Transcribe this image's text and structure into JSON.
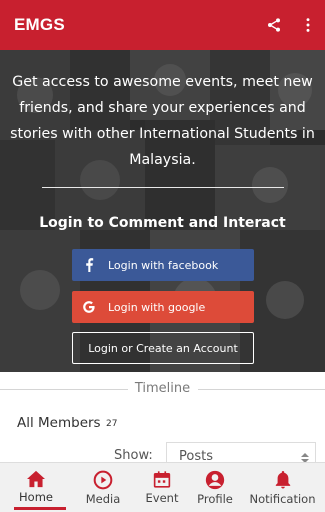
{
  "appbar": {
    "title": "EMGS",
    "share_icon": "share-icon",
    "menu_icon": "more-vert-icon",
    "color": "#c8202f"
  },
  "hero": {
    "intro_text": "Get access to awesome events, meet new friends, and share your experiences and stories with other International Students in Malaysia.",
    "login_heading": "Login to Comment and Interact",
    "facebook_label": "Login with facebook",
    "google_label": "Login with google",
    "account_label": "Login or Create an Account",
    "facebook_color": "#3b5998",
    "google_color": "#dd4b39"
  },
  "timeline": {
    "label": "Timeline"
  },
  "members": {
    "label": "All Members",
    "count": "27",
    "show_label": "Show:",
    "show_value": "Posts"
  },
  "bottom_nav": {
    "items": [
      {
        "label": "Home",
        "icon": "home-icon",
        "active": true
      },
      {
        "label": "Media",
        "icon": "play-circle-icon",
        "active": false
      },
      {
        "label": "Event",
        "icon": "calendar-icon",
        "active": false
      },
      {
        "label": "Profile",
        "icon": "profile-icon",
        "active": false
      },
      {
        "label": "Notification",
        "icon": "bell-icon",
        "active": false
      }
    ]
  }
}
